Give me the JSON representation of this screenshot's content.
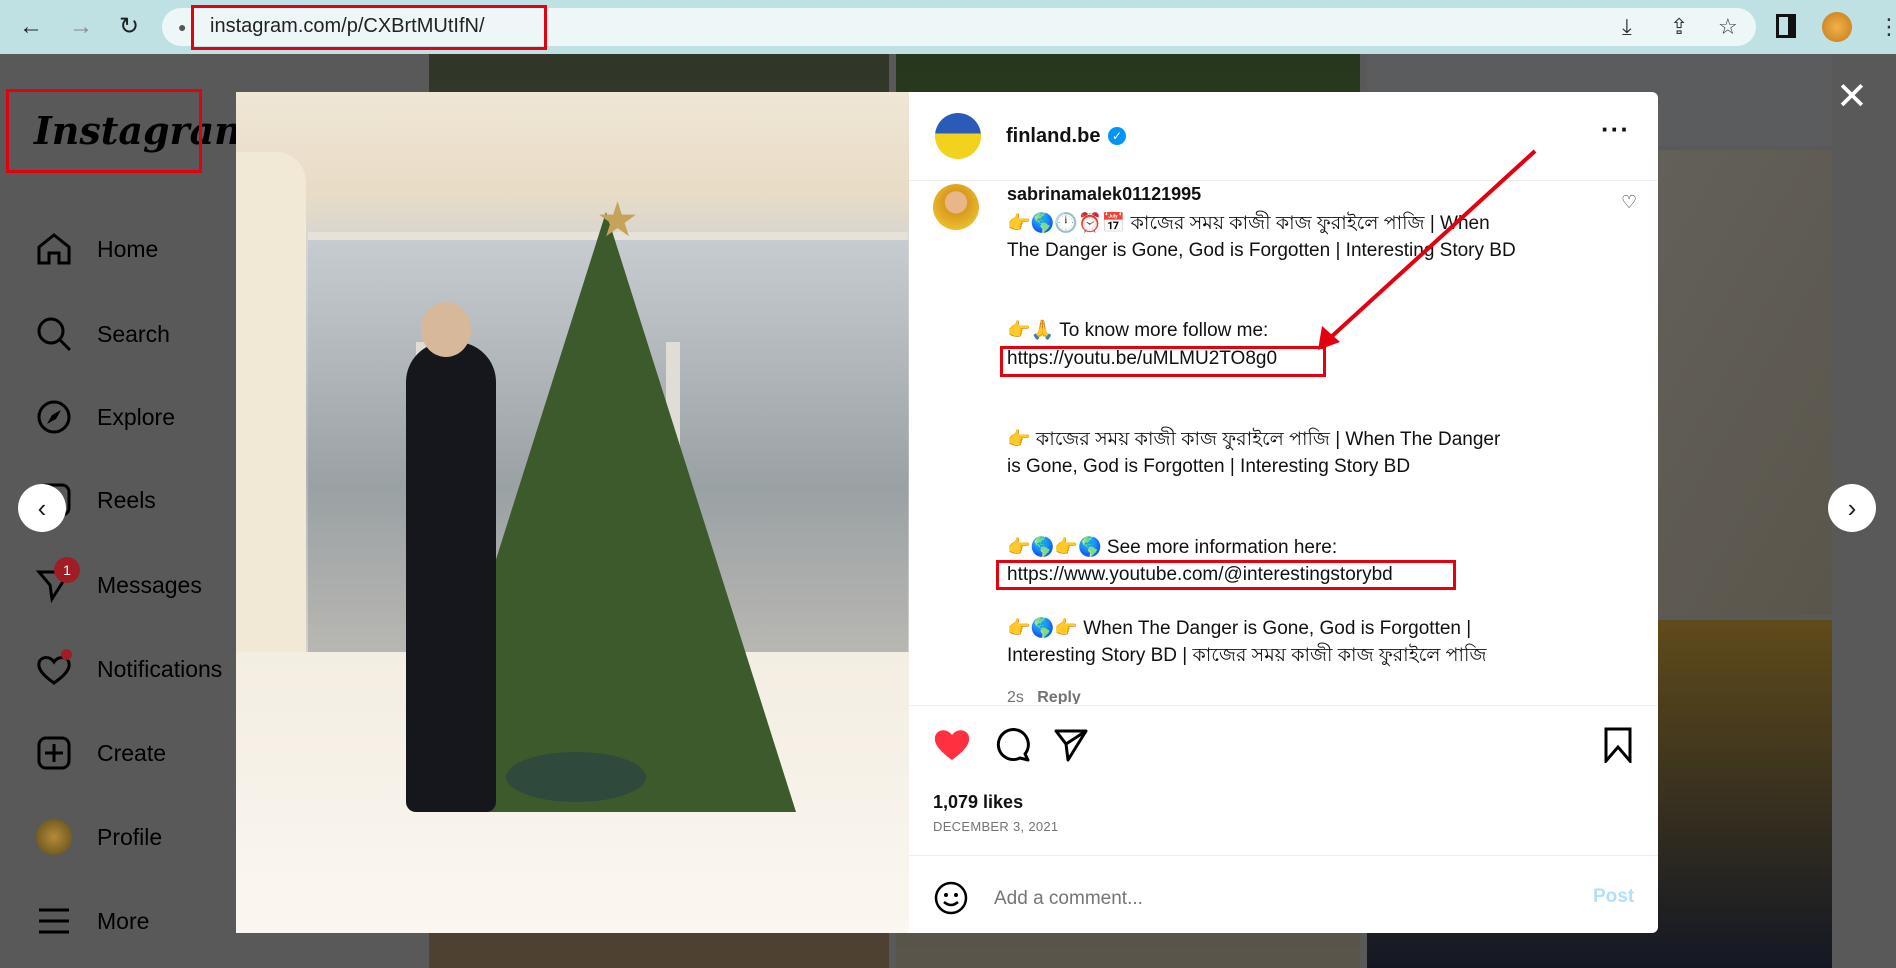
{
  "browser": {
    "url": "instagram.com/p/CXBrtMUtIfN/",
    "icons": [
      "back-icon",
      "forward-icon",
      "reload-icon",
      "lock-icon",
      "install-icon",
      "share-icon",
      "star-icon",
      "sidepanel-icon",
      "profile-avatar",
      "menu-icon"
    ]
  },
  "sidebar": {
    "logo": "Instagram",
    "items": [
      {
        "label": "Home",
        "icon": "home-icon"
      },
      {
        "label": "Search",
        "icon": "search-icon"
      },
      {
        "label": "Explore",
        "icon": "compass-icon"
      },
      {
        "label": "Reels",
        "icon": "reels-icon"
      },
      {
        "label": "Messages",
        "icon": "messages-icon",
        "badge": "1"
      },
      {
        "label": "Notifications",
        "icon": "heart-icon"
      },
      {
        "label": "Create",
        "icon": "plus-square-icon"
      },
      {
        "label": "Profile",
        "icon": "avatar"
      },
      {
        "label": "More",
        "icon": "menu-icon"
      }
    ]
  },
  "post": {
    "author": "finland.be",
    "verified": true,
    "comment": {
      "username": "sabrinamalek01121995",
      "lines": [
        "👉🌎🕛⏰📅 কাজের সময় কাজী কাজ ফুরাইলে পাজি | When",
        "The Danger is Gone, God is Forgotten | Interesting Story BD",
        "👉🙏 To know more follow me:",
        "https://youtu.be/uMLMU2TO8g0",
        "👉 কাজের সময় কাজী কাজ ফুরাইলে পাজি | When The Danger",
        "is Gone, God is Forgotten | Interesting Story BD",
        "👉🌎👉🌎 See more information here:",
        "https://www.youtube.com/@interestingstorybd",
        "👉🌎👉 When The Danger is Gone, God is Forgotten |",
        "Interesting Story BD | কাজের সময় কাজী কাজ ফুরাইলে পাজি"
      ],
      "time": "2s",
      "reply": "Reply"
    },
    "likes": "1,079 likes",
    "date": "DECEMBER 3, 2021",
    "comment_placeholder": "Add a comment...",
    "post_label": "Post",
    "liked": true
  },
  "colors": {
    "accent": "#0095f6",
    "like": "#ff3040",
    "annotation": "#e3000f"
  }
}
